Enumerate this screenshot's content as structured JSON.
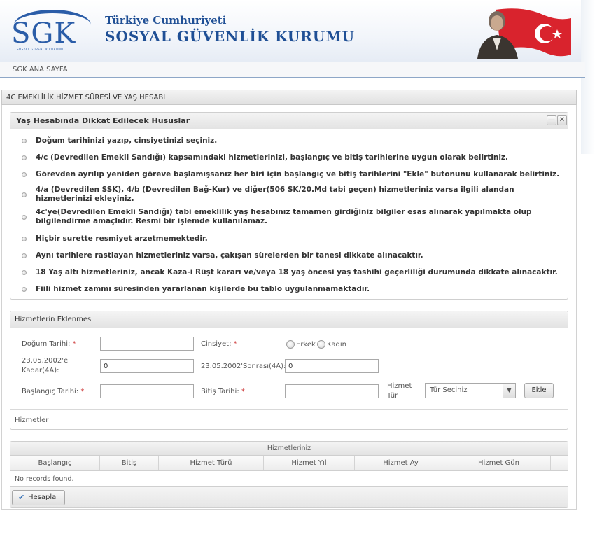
{
  "header": {
    "logo_text": "SGK",
    "logo_subtext": "SOSYAL GÜVENLİK KURUMU",
    "org_line1": "Türkiye Cumhuriyeti",
    "org_line2": "SOSYAL GÜVENLİK KURUMU"
  },
  "nav": {
    "home_link": "SGK ANA SAYFA"
  },
  "panel": {
    "title": "4C EMEKLİLİK HİZMET SÜRESİ VE YAŞ HESABI"
  },
  "notice": {
    "title": "Yaş Hesabında Dikkat Edilecek Hususlar",
    "minimize_symbol": "—",
    "close_symbol": "✕",
    "items": [
      "Doğum tarihinizi yazıp, cinsiyetinizi seçiniz.",
      "4/c (Devredilen Emekli Sandığı) kapsamındaki hizmetlerinizi, başlangıç ve bitiş tarihlerine uygun olarak belirtiniz.",
      "Görevden ayrılıp yeniden göreve başlamışsanız her biri için başlangıç ve bitiş tarihlerini \"Ekle\" butonunu kullanarak belirtiniz.",
      "4/a (Devredilen SSK), 4/b (Devredilen Bağ-Kur) ve diğer(506 SK/20.Md tabi geçen) hizmetleriniz varsa ilgili alandan hizmetlerinizi ekleyiniz.",
      "4c'ye(Devredilen Emekli Sandığı) tabi emeklilik yaş hesabınız tamamen girdiğiniz bilgiler esas alınarak yapılmakta olup bilgilendirme amaçlıdır. Resmi bir işlemde kullanılamaz.",
      "Hiçbir surette resmiyet arzetmemektedir.",
      "Aynı tarihlere rastlayan hizmetleriniz varsa, çakışan sürelerden bir tanesi dikkate alınacaktır.",
      "18 Yaş altı hizmetleriniz, ancak Kaza-i Rüşt kararı ve/veya 18 yaş öncesi yaş tashihi geçerliliği durumunda dikkate alınacaktır.",
      "Fiili hizmet zammı süresinden yararlanan kişilerde bu tablo uygulanmamaktadır."
    ]
  },
  "form": {
    "title": "Hizmetlerin Eklenmesi",
    "birth_date_label": "Doğum Tarihi:",
    "birth_date_value": "",
    "gender_label": "Cinsiyet:",
    "gender_male": "Erkek",
    "gender_female": "Kadın",
    "required_mark": "*",
    "before_2002_label_1": "23.05.2002'e",
    "before_2002_label_2": "Kadar(4A):",
    "before_2002_value": "0",
    "after_2002_label": "23.05.2002'Sonrası(4A):",
    "after_2002_value": "0",
    "start_date_label": "Başlangıç Tarihi:",
    "start_date_value": "",
    "end_date_label": "Bitiş Tarihi:",
    "end_date_value": "",
    "service_type_label_1": "Hizmet",
    "service_type_label_2": "Tür",
    "service_type_selected": "Tür Seçiniz",
    "select_arrow": "▼",
    "add_button": "Ekle",
    "services_label": "Hizmetler"
  },
  "table": {
    "caption": "Hizmetleriniz",
    "columns": [
      "Başlangıç",
      "Bitiş",
      "Hizmet Türü",
      "Hizmet Yıl",
      "Hizmet Ay",
      "Hizmet Gün"
    ],
    "empty_text": "No records found.",
    "calculate_button": "Hesapla",
    "calculate_icon": "✔"
  },
  "colors": {
    "brand_blue": "#2b5da8",
    "flag_red": "#d9232d"
  }
}
